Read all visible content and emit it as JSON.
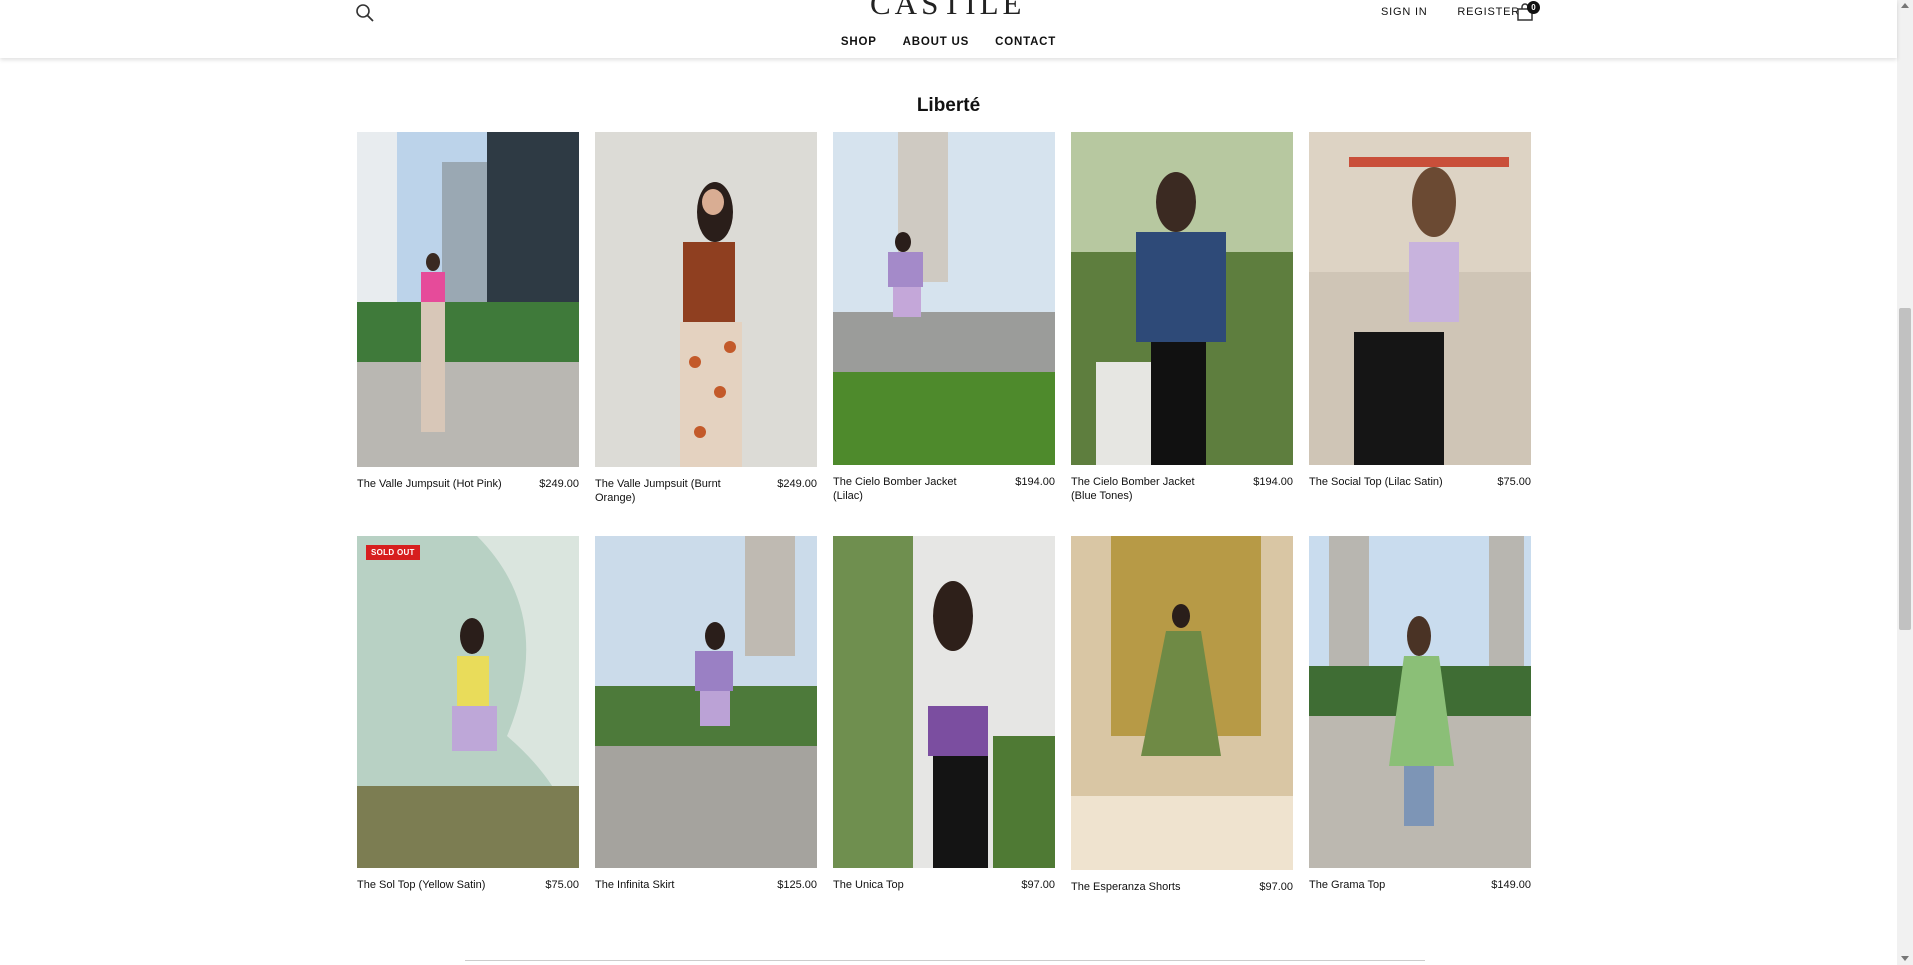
{
  "header": {
    "logo": "CASTILÉ",
    "nav": [
      "SHOP",
      "ABOUT US",
      "CONTACT"
    ],
    "sign_in": "SIGN IN",
    "register": "REGISTER",
    "cart_count": "0",
    "icons": {
      "search": "search-icon",
      "cart": "shopping-bag-icon"
    }
  },
  "collection": {
    "title": "Liberté"
  },
  "products": [
    {
      "name": "The Valle Jumpsuit (Hot Pink)",
      "price": "$249.00"
    },
    {
      "name": "The Valle Jumpsuit (Burnt Orange)",
      "price": "$249.00"
    },
    {
      "name": "The Cielo Bomber Jacket (Lilac)",
      "price": "$194.00"
    },
    {
      "name": "The Cielo Bomber Jacket (Blue Tones)",
      "price": "$194.00"
    },
    {
      "name": "The Social Top (Lilac Satin)",
      "price": "$75.00"
    },
    {
      "name": "The Sol Top (Yellow Satin)",
      "price": "$75.00",
      "badge": "SOLD OUT"
    },
    {
      "name": "The Infinita Skirt",
      "price": "$125.00"
    },
    {
      "name": "The Unica Top",
      "price": "$97.00"
    },
    {
      "name": "The Esperanza Shorts",
      "price": "$97.00"
    },
    {
      "name": "The Grama Top",
      "price": "$149.00"
    }
  ],
  "colors": {
    "sold_out": "#d71f1f"
  }
}
